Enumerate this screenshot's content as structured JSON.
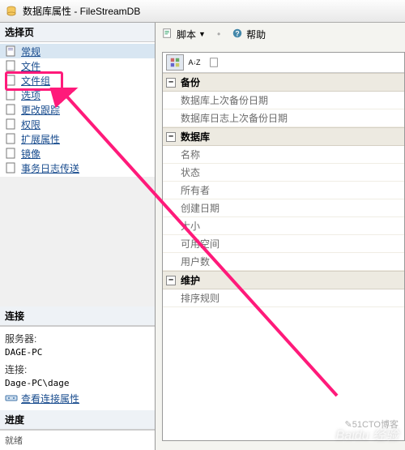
{
  "title": "数据库属性 - FileStreamDB",
  "sidebar": {
    "header": "选择页",
    "items": [
      {
        "label": "常规",
        "selected": true
      },
      {
        "label": "文件"
      },
      {
        "label": "文件组"
      },
      {
        "label": "选项"
      },
      {
        "label": "更改跟踪"
      },
      {
        "label": "权限"
      },
      {
        "label": "扩展属性"
      },
      {
        "label": "镜像"
      },
      {
        "label": "事务日志传送"
      }
    ]
  },
  "connection": {
    "header": "连接",
    "server_label": "服务器:",
    "server_value": "DAGE-PC",
    "conn_label": "连接:",
    "conn_value": "Dage-PC\\dage",
    "view_link": "查看连接属性"
  },
  "progress": {
    "header": "进度",
    "status": "就绪"
  },
  "toolbar": {
    "script": "脚本",
    "help": "帮助"
  },
  "properties": {
    "sort_az": "A↓Z",
    "categories": [
      {
        "name": "备份",
        "rows": [
          "数据库上次备份日期",
          "数据库日志上次备份日期"
        ]
      },
      {
        "name": "数据库",
        "rows": [
          "名称",
          "状态",
          "所有者",
          "创建日期",
          "大小",
          "可用空间",
          "用户数"
        ]
      },
      {
        "name": "维护",
        "rows": [
          "排序规则"
        ]
      }
    ]
  },
  "watermark_main": "Baidu 经验",
  "watermark_sub": "✎51CTO博客"
}
